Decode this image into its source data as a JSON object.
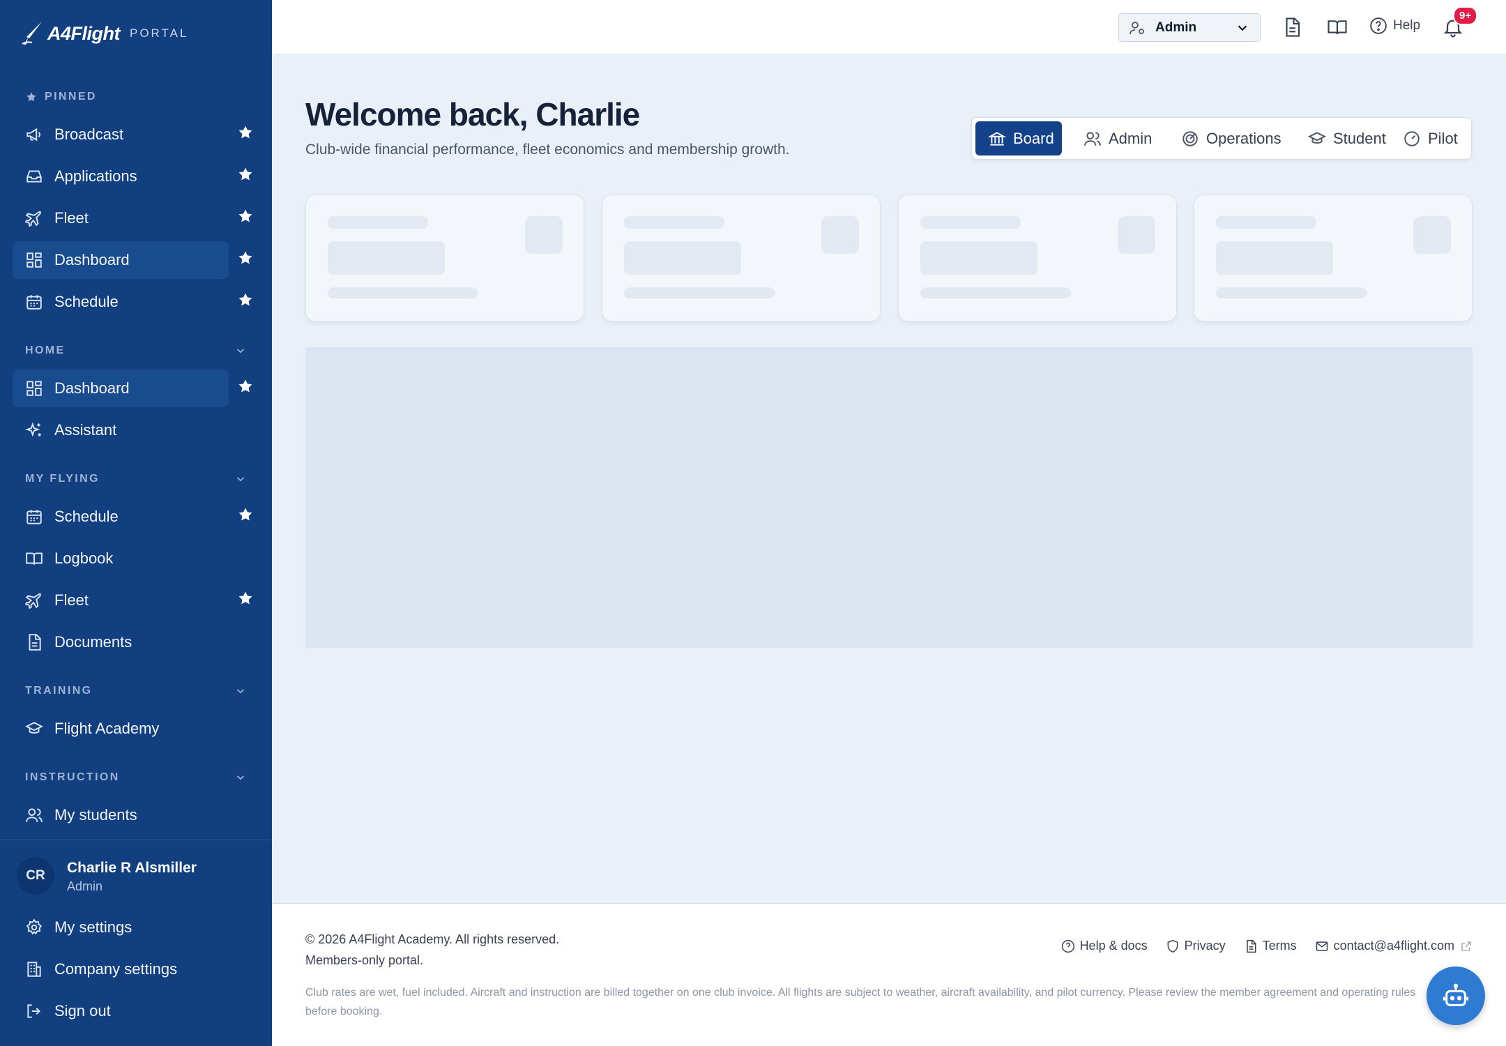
{
  "brand": {
    "name": "A4Flight",
    "portal": "PORTAL"
  },
  "sidebar": {
    "pinned_label": "PINNED",
    "pinned": [
      {
        "label": "Broadcast",
        "icon": "megaphone-icon"
      },
      {
        "label": "Applications",
        "icon": "inbox-icon"
      },
      {
        "label": "Fleet",
        "icon": "plane-icon"
      },
      {
        "label": "Dashboard",
        "icon": "dashboard-icon"
      },
      {
        "label": "Schedule",
        "icon": "calendar-icon"
      }
    ],
    "sections": {
      "home": {
        "label": "HOME",
        "items": [
          {
            "label": "Dashboard"
          },
          {
            "label": "Assistant"
          }
        ]
      },
      "my_flying": {
        "label": "MY FLYING",
        "items": [
          {
            "label": "Schedule"
          },
          {
            "label": "Logbook"
          },
          {
            "label": "Fleet"
          },
          {
            "label": "Documents"
          }
        ]
      },
      "training": {
        "label": "TRAINING",
        "items": [
          {
            "label": "Flight Academy"
          }
        ]
      },
      "instruction": {
        "label": "INSTRUCTION",
        "items": [
          {
            "label": "My students"
          }
        ]
      }
    }
  },
  "user": {
    "initials": "CR",
    "name": "Charlie R Alsmiller",
    "role": "Admin",
    "links": {
      "settings": "My settings",
      "company": "Company settings",
      "signout": "Sign out"
    }
  },
  "topbar": {
    "role_select": "Admin",
    "help": "Help",
    "notifications_badge": "9+"
  },
  "main": {
    "title": "Welcome back, Charlie",
    "subtitle": "Club-wide financial performance, fleet economics and membership growth.",
    "persona_tabs": [
      {
        "label": "Board",
        "icon": "bank-icon",
        "active": true
      },
      {
        "label": "Admin",
        "icon": "users-icon"
      },
      {
        "label": "Operations",
        "icon": "radar-icon"
      },
      {
        "label": "Student",
        "icon": "graduation-cap-icon"
      },
      {
        "label": "Pilot",
        "icon": "gauge-icon"
      }
    ]
  },
  "footer": {
    "copyright": "© 2026 A4Flight Academy. All rights reserved.",
    "members": "Members-only portal.",
    "links": {
      "help": "Help & docs",
      "privacy": "Privacy",
      "terms": "Terms",
      "contact": "contact@a4flight.com"
    },
    "disclaimer": "Club rates are wet, fuel included. Aircraft and instruction are billed together on one club invoice. All flights are subject to weather, aircraft availability, and pilot currency. Please review the member agreement and operating rules before booking."
  },
  "colors": {
    "sidebar": "#113f80",
    "accent": "#13418a",
    "background": "#e9f0f7",
    "badge": "#e11d48",
    "fab": "#2f7bd4"
  }
}
